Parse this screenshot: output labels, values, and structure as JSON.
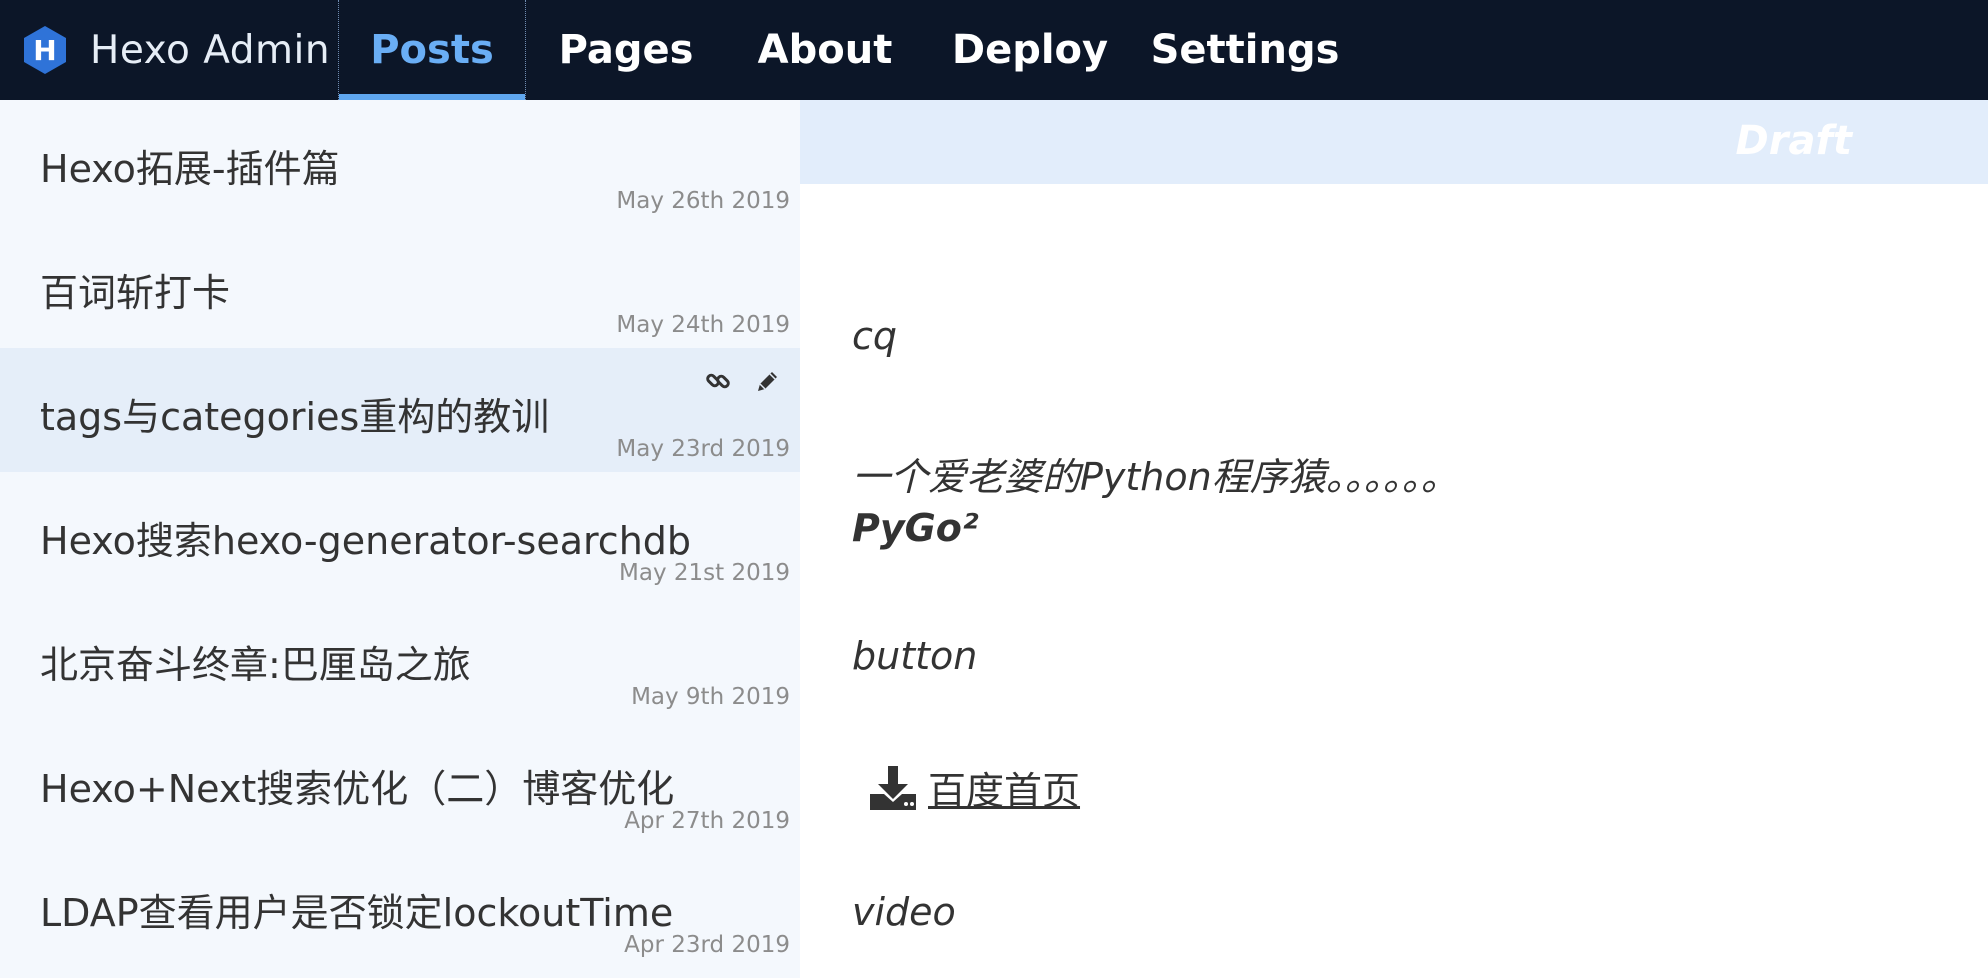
{
  "app": {
    "title": "Hexo Admin",
    "logo_letter": "H",
    "brand_color": "#2f73d8",
    "nav_background": "#0c1628",
    "accent": "#6aaef5"
  },
  "nav": {
    "tabs": [
      {
        "label": "Posts",
        "active": true
      },
      {
        "label": "Pages",
        "active": false
      },
      {
        "label": "About",
        "active": false
      },
      {
        "label": "Deploy",
        "active": false
      },
      {
        "label": "Settings",
        "active": false
      }
    ]
  },
  "posts": [
    {
      "title": "Hexo拓展-插件篇",
      "date": "May 26th 2019"
    },
    {
      "title": "百词斩打卡",
      "date": "May 24th 2019"
    },
    {
      "title": "tags与categories重构的教训",
      "date": "May 23rd 2019",
      "selected": true,
      "actions": [
        "link-icon",
        "pencil-icon"
      ]
    },
    {
      "title": "Hexo搜索hexo-generator-searchdb",
      "date": "May 21st 2019"
    },
    {
      "title": "北京奋斗终章:巴厘岛之旅",
      "date": "May 9th 2019"
    },
    {
      "title": "Hexo+Next搜索优化（二）博客优化",
      "date": "Apr 27th 2019"
    },
    {
      "title": "LDAP查看用户是否锁定lockoutTime",
      "date": "Apr 23rd 2019"
    }
  ],
  "preview": {
    "status": "Draft",
    "lines": {
      "cq": "cq",
      "bio": "一个爱老婆的Python程序猿。。。。。。",
      "name": "PyGo²",
      "button": "button",
      "link_text": "百度首页",
      "video": "video"
    },
    "link_icon": "download-icon"
  }
}
